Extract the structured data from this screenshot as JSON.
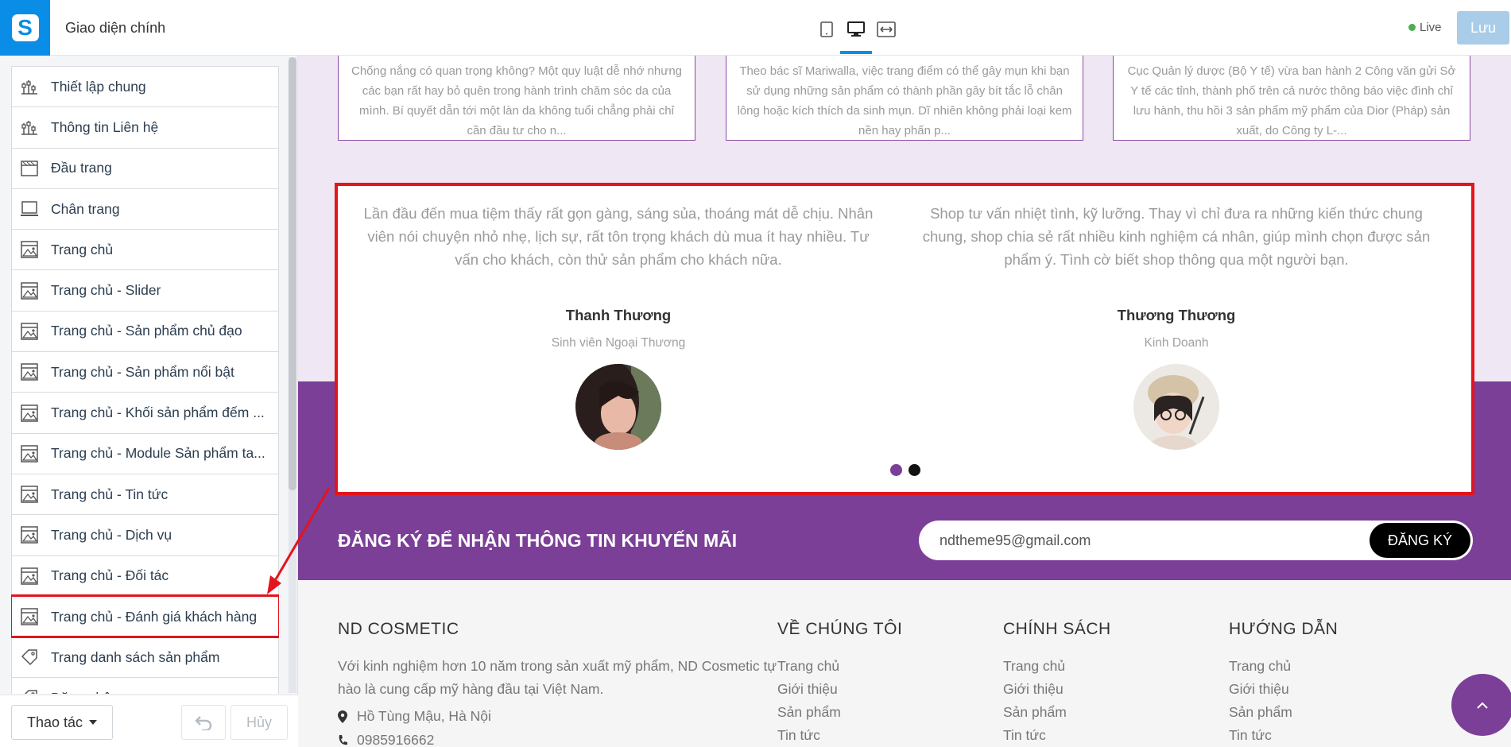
{
  "app": {
    "title": "Giao diện chính",
    "logo_letter": "S"
  },
  "sidebar": {
    "items": [
      {
        "label": "Thiết lập chung",
        "icon": "sliders-icon"
      },
      {
        "label": "Thông tin Liên hệ",
        "icon": "sliders-icon"
      },
      {
        "label": "Đầu trang",
        "icon": "header-layout-icon"
      },
      {
        "label": "Chân trang",
        "icon": "footer-layout-icon"
      },
      {
        "label": "Trang chủ",
        "icon": "page-image-icon"
      },
      {
        "label": "Trang chủ - Slider",
        "icon": "page-image-icon"
      },
      {
        "label": "Trang chủ - Sản phẩm chủ đạo",
        "icon": "page-image-icon"
      },
      {
        "label": "Trang chủ - Sản phẩm nổi bật",
        "icon": "page-image-icon"
      },
      {
        "label": "Trang chủ - Khối sản phẩm đếm ...",
        "icon": "page-image-icon"
      },
      {
        "label": "Trang chủ - Module Sản phẩm ta...",
        "icon": "page-image-icon"
      },
      {
        "label": "Trang chủ - Tin tức",
        "icon": "page-image-icon"
      },
      {
        "label": "Trang chủ - Dịch vụ",
        "icon": "page-image-icon"
      },
      {
        "label": "Trang chủ - Đối tác",
        "icon": "page-image-icon"
      },
      {
        "label": "Trang chủ - Đánh giá khách hàng",
        "icon": "page-image-icon",
        "active": true
      },
      {
        "label": "Trang danh sách sản phẩm",
        "icon": "tag-icon"
      },
      {
        "label": "Đăng nhập ...",
        "icon": "tag-icon"
      }
    ],
    "actions_label": "Thao tác",
    "cancel_label": "Hủy"
  },
  "topbar": {
    "devices": [
      "tablet-icon",
      "desktop-icon",
      "fullwidth-icon"
    ],
    "active_device": "desktop-icon",
    "live_label": "Live",
    "save_label": "Lưu"
  },
  "preview": {
    "news_cards": [
      "Chống nắng có quan trọng không? Một quy luật dễ nhớ nhưng các bạn rất hay bỏ quên trong hành trình chăm sóc da của mình. Bí quyết dẫn tới một làn da không tuổi chẳng phải chỉ cần đầu tư cho n...",
      "Theo bác sĩ Mariwalla, việc trang điểm có thể gây mụn khi bạn sử dụng những sản phẩm có thành phần gây bít tắc lỗ chân lông hoặc kích thích da sinh mụn. Dĩ nhiên không phải loại kem nền hay phấn p...",
      "Cục Quản lý dược (Bộ Y tế) vừa ban hành 2 Công văn gửi Sở Y tế các tỉnh, thành phố trên cả nước thông báo việc đình chỉ lưu hành, thu hồi 3 sản phẩm mỹ phẩm của Dior (Pháp) sản xuất, do Công ty L-..."
    ],
    "testimonials": [
      {
        "text": "Lần đầu đến mua tiệm thấy rất gọn gàng, sáng sủa, thoáng mát dễ chịu. Nhân viên nói chuyện nhỏ nhẹ, lịch sự, rất tôn trọng khách dù mua ít hay nhiều. Tư vấn cho khách, còn thử sản phẩm cho khách nữa.",
        "name": "Thanh Thương",
        "role": "Sinh viên Ngoại Thương"
      },
      {
        "text": "Shop tư vấn nhiệt tình, kỹ lưỡng. Thay vì chỉ đưa ra những kiến thức chung chung, shop chia sẻ rất nhiều kinh nghiệm cá nhân, giúp mình chọn được sản phẩm ý. Tình cờ biết shop thông qua một người bạn.",
        "name": "Thương Thương",
        "role": "Kinh Doanh"
      }
    ],
    "slider_pages": 2,
    "slider_active_page": 1,
    "newsletter": {
      "title": "ĐĂNG KÝ ĐỂ NHẬN THÔNG TIN KHUYẾN MÃI",
      "email_value": "ndtheme95@gmail.com",
      "button_label": "ĐĂNG KÝ"
    },
    "footer": {
      "brand_title": "ND COSMETIC",
      "about": "Với kinh nghiệm hơn 10 năm trong sản xuất mỹ phẩm, ND Cosmetic tự hào là cung cấp mỹ hàng đầu tại Việt Nam.",
      "address": "Hồ Tùng Mậu, Hà Nội",
      "phone": "0985916662",
      "columns": [
        {
          "title": "VỀ CHÚNG TÔI",
          "links": [
            "Trang chủ",
            "Giới thiệu",
            "Sản phẩm",
            "Tin tức"
          ]
        },
        {
          "title": "CHÍNH SÁCH",
          "links": [
            "Trang chủ",
            "Giới thiệu",
            "Sản phẩm",
            "Tin tức"
          ]
        },
        {
          "title": "HƯỚNG DẪN",
          "links": [
            "Trang chủ",
            "Giới thiệu",
            "Sản phẩm",
            "Tin tức"
          ]
        }
      ]
    }
  },
  "colors": {
    "brand_blue": "#0a8de6",
    "theme_purple": "#7b3f98",
    "highlight_red": "#e3141c",
    "live_green": "#4caf50"
  }
}
